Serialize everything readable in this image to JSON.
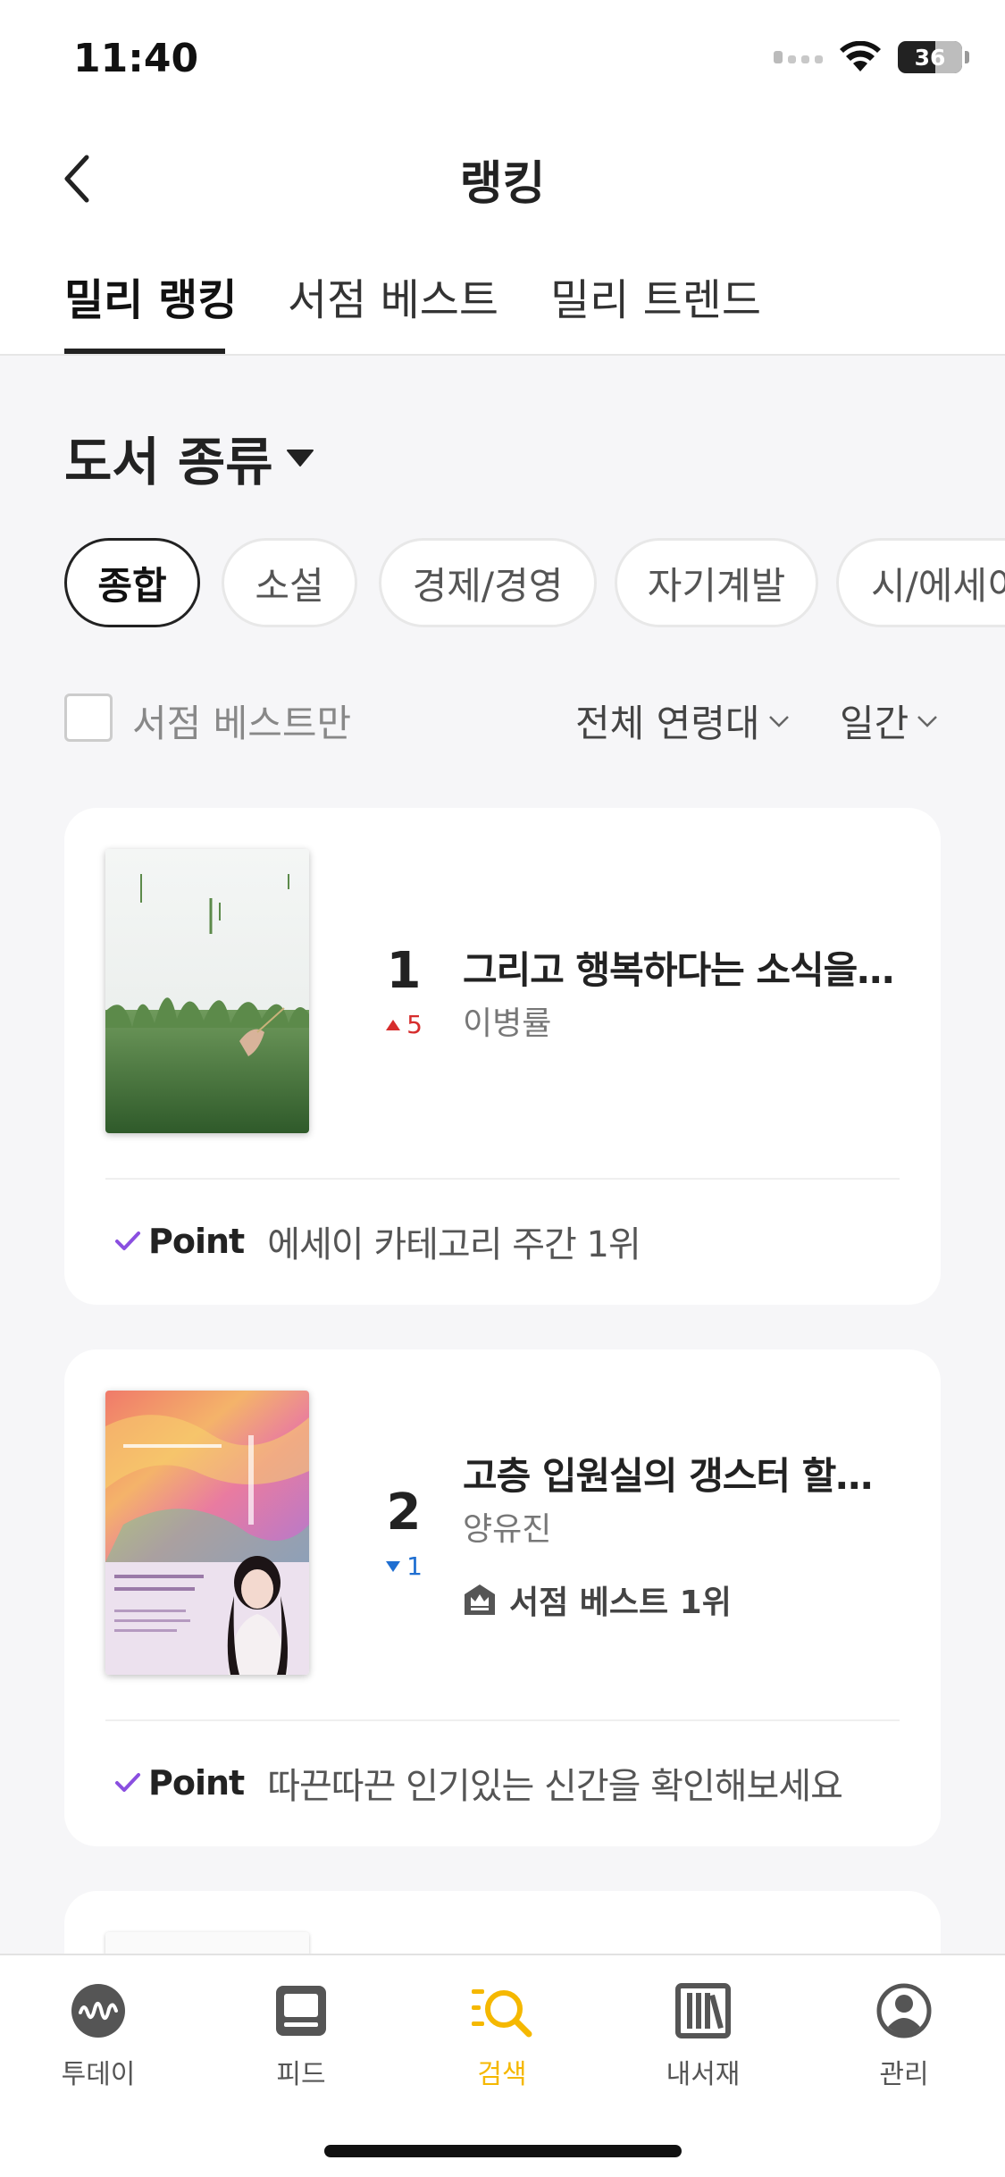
{
  "status": {
    "time": "11:40",
    "battery": "36"
  },
  "header": {
    "title": "랭킹"
  },
  "tabs": [
    {
      "label": "밀리 랭킹",
      "active": true
    },
    {
      "label": "서점 베스트",
      "active": false
    },
    {
      "label": "밀리 트렌드",
      "active": false
    }
  ],
  "category": {
    "label": "도서 종류"
  },
  "chips": [
    "종합",
    "소설",
    "경제/경영",
    "자기계발",
    "시/에세이"
  ],
  "filters": {
    "bookstore_best_only": "서점 베스트만",
    "age": "전체 연령대",
    "period": "일간"
  },
  "books": [
    {
      "rank": "1",
      "change": "5",
      "change_dir": "up",
      "title": "그리고 행복하다는 소식을 들었다",
      "author": "이병률",
      "point_label": "Point",
      "point_text": "에세이 카테고리 주간 1위"
    },
    {
      "rank": "2",
      "change": "1",
      "change_dir": "down",
      "title": "고층 입원실의 갱스터 할머니",
      "author": "양유진",
      "badge": "서점 베스트 1위",
      "point_label": "Point",
      "point_text": "따끈따끈 인기있는 신간을 확인해보세요"
    }
  ],
  "tabbar": [
    {
      "label": "투데이",
      "icon": "today-icon"
    },
    {
      "label": "피드",
      "icon": "feed-icon"
    },
    {
      "label": "검색",
      "icon": "search-icon",
      "active": true
    },
    {
      "label": "내서재",
      "icon": "library-icon"
    },
    {
      "label": "관리",
      "icon": "profile-icon"
    }
  ],
  "colors": {
    "accent": "#f5b800",
    "up": "#d62d2d",
    "down": "#1f6fd1",
    "check": "#8a4fe0"
  }
}
